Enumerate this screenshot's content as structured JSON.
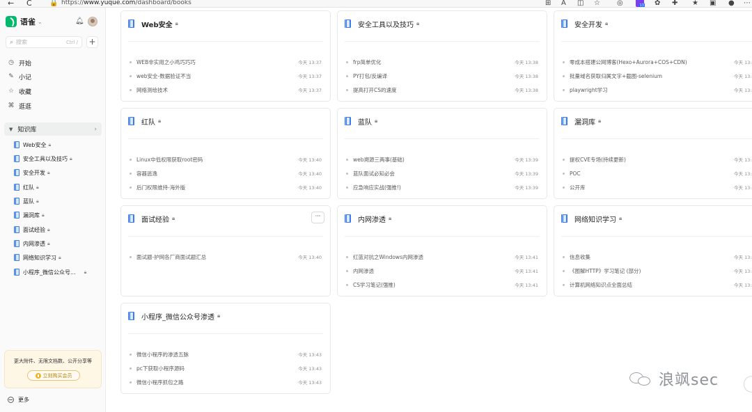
{
  "browser": {
    "back": "←",
    "reload": "C",
    "url_prefix": "https://",
    "url_host": "www.yuque.com",
    "url_path": "/dashboard/books",
    "extension_badge": "13"
  },
  "sidebar": {
    "brand": "语雀",
    "search_placeholder": "搜索",
    "search_shortcut": "Ctrl /",
    "nav": [
      {
        "label": "开始",
        "icon": "clock-icon"
      },
      {
        "label": "小记",
        "icon": "pen-icon"
      },
      {
        "label": "收藏",
        "icon": "star-icon"
      },
      {
        "label": "逛逛",
        "icon": "apps-icon"
      }
    ],
    "kb_header": "知识库",
    "books": [
      {
        "label": "Web安全"
      },
      {
        "label": "安全工具以及技巧"
      },
      {
        "label": "安全开发"
      },
      {
        "label": "红队"
      },
      {
        "label": "蓝队"
      },
      {
        "label": "漏洞库"
      },
      {
        "label": "面试经验"
      },
      {
        "label": "内网渗透"
      },
      {
        "label": "网络知识学习"
      },
      {
        "label": "小程序_微信公众号..."
      }
    ],
    "promo_text": "更大附件、无限文档数、公开分享等",
    "promo_button": "立刻购买会员",
    "more": "更多"
  },
  "cards": [
    {
      "title": "Web安全",
      "bold": true,
      "docs": [
        {
          "title": "WEB非实用之小鸡巧巧巧",
          "time": "今天 13:37"
        },
        {
          "title": "web安全-数据验证不当",
          "time": "今天 13:37"
        },
        {
          "title": "网络测绘技术",
          "time": "今天 13:37"
        }
      ]
    },
    {
      "title": "安全工具以及技巧",
      "bold": false,
      "docs": [
        {
          "title": "frp简单优化",
          "time": "今天 13:38"
        },
        {
          "title": "PY打包/反编译",
          "time": "今天 13:38"
        },
        {
          "title": "提高打开CS的速度",
          "time": "今天 13:38"
        }
      ]
    },
    {
      "title": "安全开发",
      "bold": false,
      "docs": [
        {
          "title": "零成本搭建公网博客(Hexo+Aurora+COS+CDN)",
          "time": "今天 13:3"
        },
        {
          "title": "批量域名获取归属文字+截图-selenium",
          "time": "今天 13:3"
        },
        {
          "title": "playwright学习",
          "time": "今天 13:3"
        }
      ]
    },
    {
      "title": "红队",
      "bold": false,
      "docs": [
        {
          "title": "Linux中低权限获取root密码",
          "time": "今天 13:40"
        },
        {
          "title": "容器逃逸",
          "time": "今天 13:40"
        },
        {
          "title": "后门权限维持-海外版",
          "time": "今天 13:40"
        }
      ]
    },
    {
      "title": "蓝队",
      "bold": false,
      "docs": [
        {
          "title": "web溯源三两事(基础)",
          "time": "今天 13:39"
        },
        {
          "title": "蓝队面试必知必会",
          "time": "今天 13:39"
        },
        {
          "title": "应急响应实战(强推!)",
          "time": "今天 13:39"
        }
      ]
    },
    {
      "title": "漏洞库",
      "bold": false,
      "docs": [
        {
          "title": "提权CVE专场(持续更新)",
          "time": "今天 13:4"
        },
        {
          "title": "POC",
          "time": "今天 13:4"
        },
        {
          "title": "公开库",
          "time": "今天 13:4"
        }
      ]
    },
    {
      "title": "面试经验",
      "bold": false,
      "more_button": "···",
      "docs": [
        {
          "title": "面试题-护网各厂商面试题汇总",
          "time": "今天 13:40"
        }
      ]
    },
    {
      "title": "内网渗透",
      "bold": false,
      "docs": [
        {
          "title": "红蓝对抗之Windows内网渗透",
          "time": "今天 13:41"
        },
        {
          "title": "内网渗透",
          "time": "今天 13:41"
        },
        {
          "title": "CS学习笔记(强推)",
          "time": "今天 13:41"
        }
      ]
    },
    {
      "title": "网络知识学习",
      "bold": false,
      "docs": [
        {
          "title": "信息收集",
          "time": "今天 13:4"
        },
        {
          "title": "《图解HTTP》学习笔记 (部分)",
          "time": "今天 13:4"
        },
        {
          "title": "计算机网络知识点全面总结",
          "time": "今天 13:4"
        }
      ]
    },
    {
      "title": "小程序_微信公众号渗透",
      "bold": false,
      "docs": [
        {
          "title": "微信小程序的渗透五脉",
          "time": "今天 13:43"
        },
        {
          "title": "pc下获取小程序源码",
          "time": "今天 13:43"
        },
        {
          "title": "微信小程序抓包之路",
          "time": "今天 13:43"
        }
      ]
    }
  ],
  "watermark": "浪飒sec",
  "colors": {
    "brand": "#00b96b",
    "book_icon": "#3a7af0",
    "promo_bg": "#fff7e6"
  }
}
